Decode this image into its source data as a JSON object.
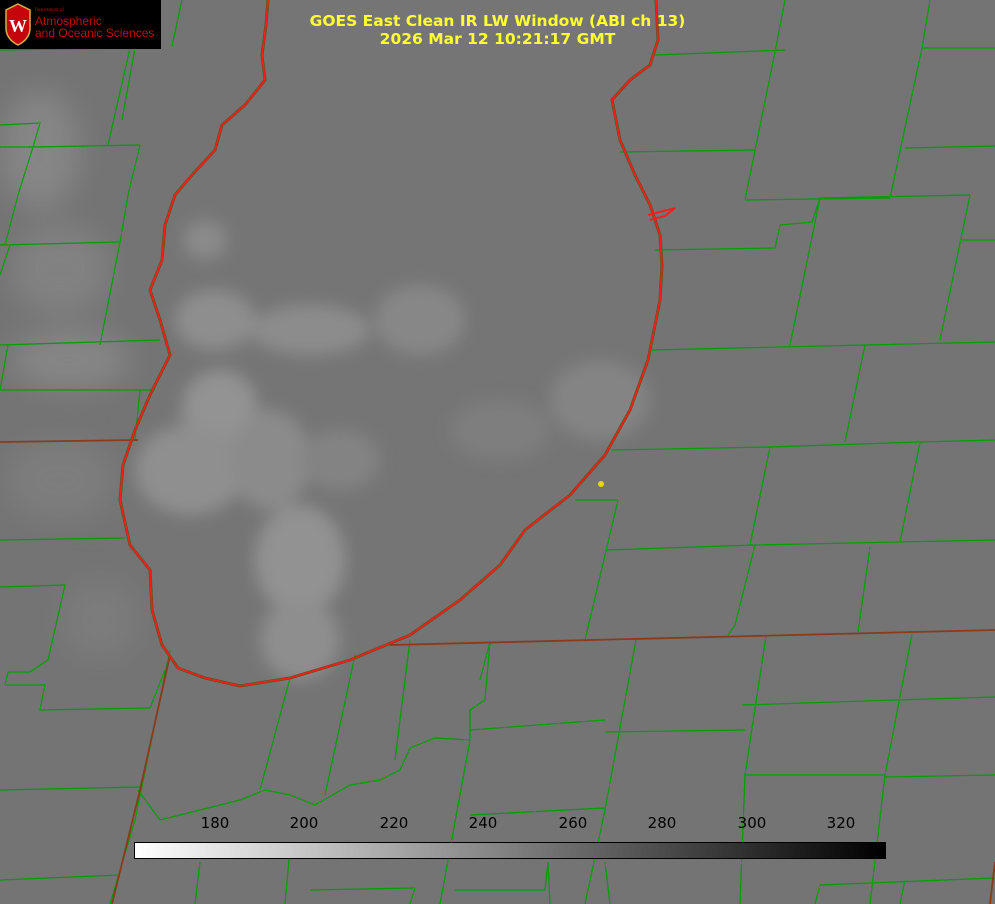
{
  "title": {
    "line1": "GOES East Clean IR LW Window (ABI ch 13)",
    "line2": "2026 Mar 12 10:21:17 GMT"
  },
  "logo": {
    "department": "Department of",
    "line1": "Atmospheric",
    "line2": "and Oceanic Sciences",
    "crest_letter": "W"
  },
  "colorbar": {
    "tick_labels": [
      "180",
      "200",
      "220",
      "240",
      "260",
      "280",
      "300",
      "320"
    ],
    "gradient_start": "#ffffff",
    "gradient_end": "#000000"
  },
  "colors": {
    "background_gray": "#747474",
    "county_lines": "#00a000",
    "coastline": "#ff1a1a",
    "state_border": "#8b3a1a",
    "title_text": "#ffff33",
    "marker": "#e6d60a"
  }
}
